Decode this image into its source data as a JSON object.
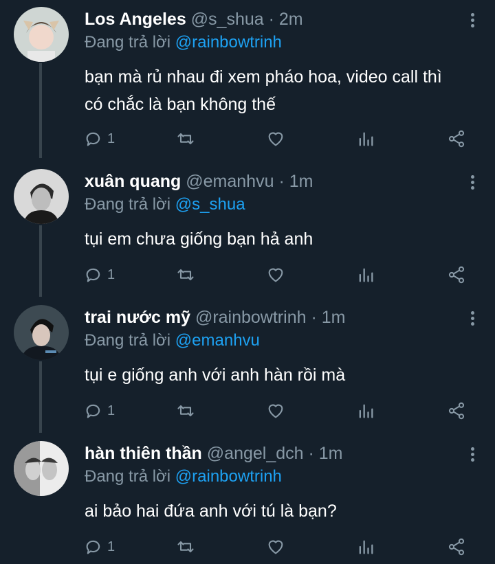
{
  "replying_label": "Đang trả lời",
  "tweets": [
    {
      "name": "Los Angeles",
      "handle": "@s_shua",
      "separator": "·",
      "time": "2m",
      "replying_to": "@rainbowtrinh",
      "text_lines": [
        "bạn mà rủ nhau đi xem pháo hoa, video call thì",
        "có chắc là bạn không thế"
      ],
      "reply_count": "1"
    },
    {
      "name": "xuân quang",
      "handle": "@emanhvu",
      "separator": "·",
      "time": "1m",
      "replying_to": "@s_shua",
      "text_lines": [
        "tụi em chưa giống bạn hả anh"
      ],
      "reply_count": "1"
    },
    {
      "name": "trai nước mỹ",
      "handle": "@rainbowtrinh",
      "separator": "·",
      "time": "1m",
      "replying_to": "@emanhvu",
      "text_lines": [
        "tụi e giống anh với anh hàn rồi mà"
      ],
      "reply_count": "1"
    },
    {
      "name": "hàn thiên thần",
      "handle": "@angel_dch",
      "separator": "·",
      "time": "1m",
      "replying_to": "@rainbowtrinh",
      "text_lines": [
        "ai bảo hai đứa anh với tú là bạn?"
      ],
      "reply_count": "1"
    }
  ],
  "icons": {
    "reply": "reply-icon",
    "retweet": "retweet-icon",
    "like": "heart-icon",
    "analytics": "analytics-icon",
    "share": "share-icon",
    "more": "more-vertical-icon"
  },
  "colors": {
    "background": "#15202b",
    "text": "#ffffff",
    "muted": "#8899a6",
    "link": "#1da1f2",
    "thread_line": "#38444d"
  }
}
